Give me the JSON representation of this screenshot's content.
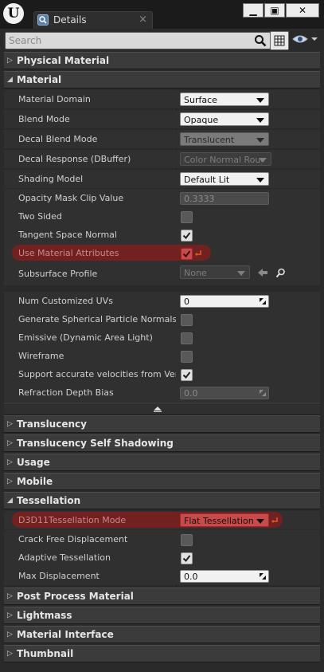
{
  "window": {
    "tab_title": "Details",
    "tab_close": "×",
    "logo": "U",
    "minimize": "▁",
    "maximize": "▣",
    "close": "✕"
  },
  "search": {
    "placeholder": "Search"
  },
  "categories": {
    "physical_material": "Physical Material",
    "material": "Material",
    "translucency": "Translucency",
    "translucency_self_shadowing": "Translucency Self Shadowing",
    "usage": "Usage",
    "mobile": "Mobile",
    "tessellation": "Tessellation",
    "post_process_material": "Post Process Material",
    "lightmass": "Lightmass",
    "material_interface": "Material Interface",
    "thumbnail": "Thumbnail"
  },
  "material": {
    "material_domain": {
      "label": "Material Domain",
      "value": "Surface"
    },
    "blend_mode": {
      "label": "Blend Mode",
      "value": "Opaque"
    },
    "decal_blend_mode": {
      "label": "Decal Blend Mode",
      "value": "Translucent"
    },
    "decal_response": {
      "label": "Decal Response (DBuffer)",
      "value": "Color Normal Roughness"
    },
    "shading_model": {
      "label": "Shading Model",
      "value": "Default Lit"
    },
    "opacity_mask_clip": {
      "label": "Opacity Mask Clip Value",
      "value": "0.3333"
    },
    "two_sided": {
      "label": "Two Sided",
      "checked": false
    },
    "tangent_space_normal": {
      "label": "Tangent Space Normal",
      "checked": true
    },
    "use_material_attributes": {
      "label": "Use Material Attributes",
      "checked": true
    },
    "subsurface_profile": {
      "label": "Subsurface Profile",
      "value": "None"
    },
    "num_customized_uvs": {
      "label": "Num Customized UVs",
      "value": "0"
    },
    "generate_spherical_particle_normals": {
      "label": "Generate Spherical Particle Normals",
      "checked": false
    },
    "emissive_dynamic_area_light": {
      "label": "Emissive (Dynamic Area Light)",
      "checked": false
    },
    "wireframe": {
      "label": "Wireframe",
      "checked": false
    },
    "support_accurate_velocities": {
      "label": "Support accurate velocities from Vertex",
      "checked": true
    },
    "refraction_depth_bias": {
      "label": "Refraction Depth Bias",
      "value": "0.0"
    }
  },
  "tessellation": {
    "d3d11_tessellation_mode": {
      "label": "D3D11Tessellation Mode",
      "value": "Flat Tessellation"
    },
    "crack_free_displacement": {
      "label": "Crack Free Displacement",
      "checked": false
    },
    "adaptive_tessellation": {
      "label": "Adaptive Tessellation",
      "checked": true
    },
    "max_displacement": {
      "label": "Max Displacement",
      "value": "0.0"
    }
  },
  "colors": {
    "highlight_red": "#7a1f1f",
    "modified_red": "#c94a4a",
    "panel_bg": "#2a2a2a",
    "category_bg": "#3b3b3b"
  },
  "icons": {
    "search": "search-icon",
    "view_options": "eye-icon",
    "property_matrix": "grid-icon",
    "expand": "triangle-right-icon",
    "collapse": "triangle-down-icon",
    "reset_to_default": "reset-arrow-icon",
    "browse": "arrow-left-icon",
    "find": "magnifier-icon",
    "advanced_toggle": "triangle-up-icon"
  }
}
